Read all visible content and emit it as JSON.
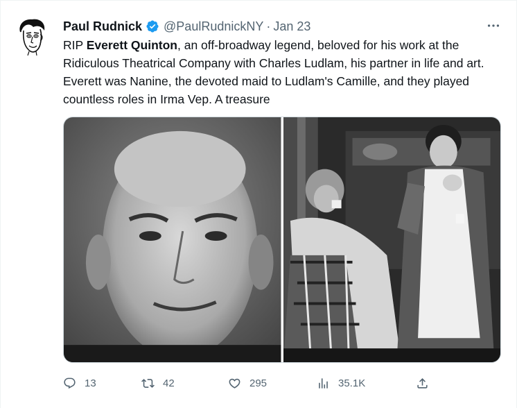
{
  "user": {
    "name": "Paul Rudnick",
    "handle": "@PaulRudnickNY",
    "separator": "·",
    "date": "Jan 23",
    "verified_color": "#1d9bf0"
  },
  "tweet": {
    "part1": "RIP ",
    "bold_name": "Everett Quinton",
    "part2": ", an off-broadway legend, beloved for his work at the Ridiculous Theatrical Company with Charles Ludlam, his partner in life and art. Everett was Nanine, the devoted maid to Ludlam's Camille, and they played countless roles in Irma Vep. A treasure"
  },
  "actions": {
    "replies": "13",
    "retweets": "42",
    "likes": "295",
    "views": "35.1K"
  },
  "icons": {
    "more": "more-icon",
    "reply": "reply-icon",
    "retweet": "retweet-icon",
    "like": "heart-icon",
    "views": "views-icon",
    "share": "share-icon"
  },
  "colors": {
    "text": "#0f1419",
    "muted": "#536471",
    "accent": "#1d9bf0"
  }
}
